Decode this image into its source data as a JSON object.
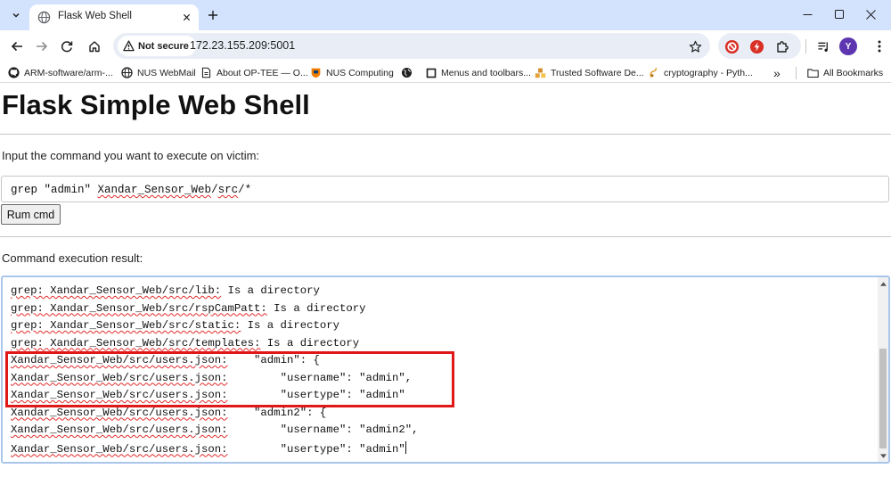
{
  "browser": {
    "tab_title": "Flask Web Shell",
    "security_label": "Not secure",
    "url": "172.23.155.209:5001",
    "profile_initial": "Y"
  },
  "bookmarks": [
    {
      "label": "ARM-software/arm-...",
      "icon": "github-icon"
    },
    {
      "label": "NUS WebMail",
      "icon": "globe-icon"
    },
    {
      "label": "About OP-TEE — O...",
      "icon": "page-icon"
    },
    {
      "label": "NUS Computing",
      "icon": "nus-icon"
    },
    {
      "label": "",
      "icon": "globe-icon"
    },
    {
      "label": "Menus and toolbars...",
      "icon": "square-icon"
    },
    {
      "label": "Trusted Software De...",
      "icon": "blocks-icon"
    },
    {
      "label": "cryptography - Pyth...",
      "icon": "crypto-icon"
    }
  ],
  "bookmarks_more": "»",
  "all_bookmarks_label": "All Bookmarks",
  "page": {
    "heading": "Flask Simple Web Shell",
    "prompt_label": "Input the command you want to execute on victim:",
    "command_value": "grep \"admin\" Xandar_Sensor_Web/src/*",
    "run_button_label": "Rum cmd",
    "result_label": "Command execution result:"
  },
  "result_lines": [
    {
      "path": "grep: Xandar_Sensor_Web/src/lib:",
      "rest": " Is a directory"
    },
    {
      "path": "grep: Xandar_Sensor_Web/src/rspCamPatt:",
      "rest": " Is a directory"
    },
    {
      "path": "grep: Xandar_Sensor_Web/src/static:",
      "rest": " Is a directory"
    },
    {
      "path": "grep: Xandar_Sensor_Web/src/templates:",
      "rest": " Is a directory"
    },
    {
      "path": "Xandar_Sensor_Web/src/users.json:",
      "rest": "    \"admin\": {"
    },
    {
      "path": "Xandar_Sensor_Web/src/users.json:",
      "rest": "        \"username\": \"admin\","
    },
    {
      "path": "Xandar_Sensor_Web/src/users.json:",
      "rest": "        \"usertype\": \"admin\""
    },
    {
      "path": "Xandar_Sensor_Web/src/users.json:",
      "rest": "    \"admin2\": {"
    },
    {
      "path": "Xandar_Sensor_Web/src/users.json:",
      "rest": "        \"username\": \"admin2\","
    },
    {
      "path": "Xandar_Sensor_Web/src/users.json:",
      "rest": "        \"usertype\": \"admin\""
    }
  ],
  "colors": {
    "tabstrip": "#d3e3fd",
    "highlight_box": "#e01818",
    "spell_squiggle": "#e32b2b",
    "result_border": "#a9c6ea"
  }
}
